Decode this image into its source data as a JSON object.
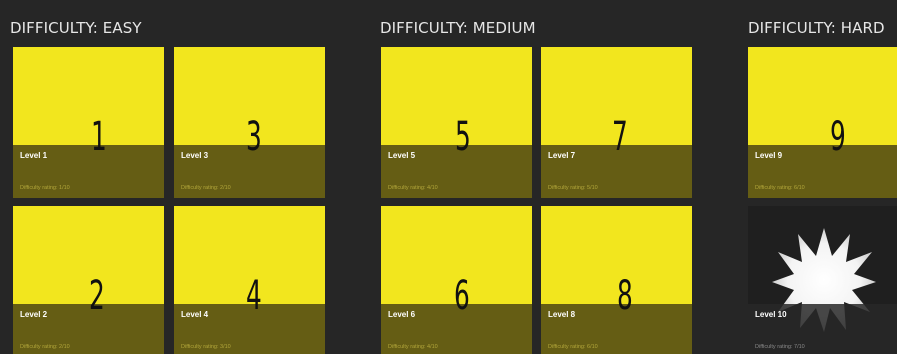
{
  "groups": [
    {
      "header": "DIFFICULTY: EASY"
    },
    {
      "header": "DIFFICULTY: MEDIUM"
    },
    {
      "header": "DIFFICULTY: HARD"
    }
  ],
  "levels": [
    {
      "number": "1",
      "title": "Level 1",
      "rating": "Difficulty rating: 1/10"
    },
    {
      "number": "2",
      "title": "Level 2",
      "rating": "Difficulty rating: 2/10"
    },
    {
      "number": "3",
      "title": "Level 3",
      "rating": "Difficulty rating: 2/10"
    },
    {
      "number": "4",
      "title": "Level 4",
      "rating": "Difficulty rating: 3/10"
    },
    {
      "number": "5",
      "title": "Level 5",
      "rating": "Difficulty rating: 4/10"
    },
    {
      "number": "6",
      "title": "Level 6",
      "rating": "Difficulty rating: 4/10"
    },
    {
      "number": "7",
      "title": "Level 7",
      "rating": "Difficulty rating: 5/10"
    },
    {
      "number": "8",
      "title": "Level 8",
      "rating": "Difficulty rating: 6/10"
    },
    {
      "number": "9",
      "title": "Level 9",
      "rating": "Difficulty rating: 6/10"
    },
    {
      "number": "",
      "title": "Level 10",
      "rating": "Difficulty rating: 7/10",
      "icon": "starburst-icon"
    }
  ],
  "colors": {
    "background": "#262626",
    "tile_yellow": "#f2e61e",
    "overlay": "#463e12",
    "header_text": "#e6e6e6"
  }
}
